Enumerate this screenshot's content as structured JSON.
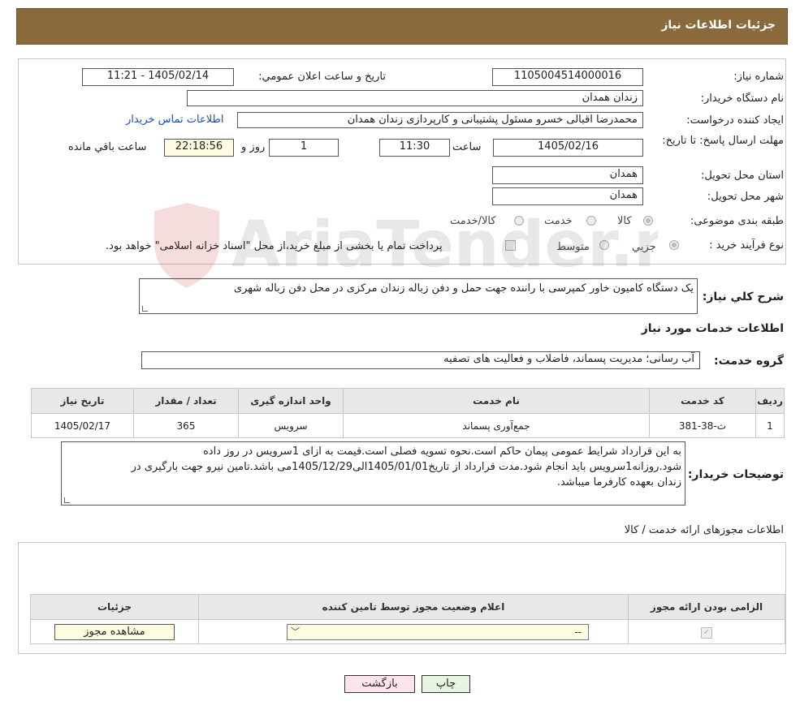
{
  "header": {
    "title": "جزئیات اطلاعات نیاز"
  },
  "form": {
    "need_number_label": "شماره نیاز:",
    "need_number": "1105004514000016",
    "announce_label": "تاریخ و ساعت اعلان عمومي:",
    "announce_value": "1405/02/14 - 11:21",
    "buyer_org_label": "نام دستگاه خريدار:",
    "buyer_org": "زندان همدان",
    "creator_label": "ايجاد کننده درخواست:",
    "creator": "محمدرضا اقبالی خسرو مسئول پشتیبانی و کارپردازی زندان همدان",
    "contact_link": "اطلاعات تماس خريدار",
    "deadline_label": "مهلت ارسال پاسخ: تا تاريخ:",
    "deadline_date": "1405/02/16",
    "time_label": "ساعت",
    "deadline_time": "11:30",
    "days_value": "1",
    "days_label": "روز و",
    "remaining_time": "22:18:56",
    "remaining_label": "ساعت باقي مانده",
    "province_label": "استان محل تحويل:",
    "province": "همدان",
    "city_label": "شهر محل تحويل:",
    "city": "همدان",
    "category_label": "طبقه بندی موضوعی:",
    "category_options": [
      "کالا",
      "خدمت",
      "کالا/خدمت"
    ],
    "process_label": "نوع فرآيند خريد :",
    "process_options": [
      "جزيي",
      "متوسط"
    ],
    "process_note": "پرداخت تمام يا بخشی از مبلغ خريد،از محل \"اسناد خزانه اسلامی\" خواهد بود."
  },
  "description": {
    "label": "شرح کلي نياز:",
    "text": "یک دستگاه کامیون خاور کمپرسی با راننده جهت حمل و دفن زباله زندان مرکزی در محل دفن زباله شهری"
  },
  "services": {
    "section_title": "اطلاعات خدمات مورد نياز",
    "group_label": "گروه خدمت:",
    "group_value": "آب رسانی؛ مديريت پسماند، فاضلاب و فعاليت های تصفيه",
    "columns": [
      "رديف",
      "کد خدمت",
      "نام خدمت",
      "واحد اندازه گيری",
      "تعداد / مقدار",
      "تاريخ نياز"
    ],
    "rows": [
      [
        "1",
        "ث-38-381",
        "جمع‌آوری پسماند",
        "سرويس",
        "365",
        "1405/02/17"
      ]
    ]
  },
  "buyer_notes": {
    "label": "توضيحات خريدار:",
    "lines": [
      "به این قرارداد شرایط عمومی پیمان حاکم است.نحوه تسویه فصلی است.قیمت به ازای 1سرویس در روز داده",
      "شود.روزانه1سرویس باید انجام شود.مدت قرارداد از تاریخ1405/01/01الی1405/12/29می باشد.تامین نیرو جهت بارگیری در",
      "زندان بعهده کارفرما میباشد."
    ]
  },
  "permits": {
    "section_title": "اطلاعات مجوزهای ارائه خدمت / کالا",
    "columns": [
      "الزامی بودن ارائه مجوز",
      "اعلام وضعیت مجوز توسط تامین کننده",
      "جزئيات"
    ],
    "select_value": "--",
    "view_button": "مشاهده مجوز"
  },
  "actions": {
    "print": "چاپ",
    "back": "بازگشت"
  },
  "watermark": {
    "text": "AriaTender.neT"
  }
}
